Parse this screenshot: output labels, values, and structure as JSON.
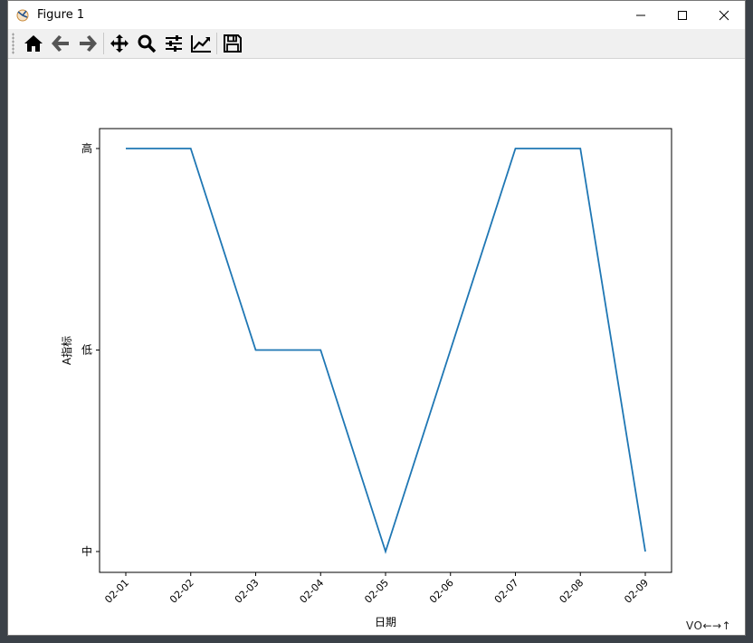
{
  "window": {
    "title": "Figure 1",
    "app_icon": "matplotlib-icon",
    "controls": [
      "minimize-icon",
      "maximize-icon",
      "close-icon"
    ]
  },
  "toolbar": {
    "buttons": [
      {
        "name": "home-button",
        "icon": "home-icon"
      },
      {
        "name": "back-button",
        "icon": "arrow-left-icon"
      },
      {
        "name": "forward-button",
        "icon": "arrow-right-icon"
      },
      {
        "name": "pan-button",
        "icon": "move-icon"
      },
      {
        "name": "zoom-button",
        "icon": "magnifier-icon"
      },
      {
        "name": "configure-subplots-button",
        "icon": "sliders-icon"
      },
      {
        "name": "edit-axis-button",
        "icon": "line-chart-icon"
      },
      {
        "name": "save-button",
        "icon": "floppy-disk-icon"
      }
    ]
  },
  "chart_data": {
    "type": "line",
    "x": [
      "02-01",
      "02-02",
      "02-03",
      "02-04",
      "02-05",
      "02-06",
      "02-07",
      "02-08",
      "02-09"
    ],
    "y_categories": [
      "中",
      "低",
      "高"
    ],
    "values": [
      "高",
      "高",
      "低",
      "低",
      "中",
      "低",
      "高",
      "高",
      "中"
    ],
    "xlabel": "日期",
    "ylabel": "A指标",
    "line_color": "#1f77b4",
    "grid": false
  },
  "watermark": "VO←→↑"
}
